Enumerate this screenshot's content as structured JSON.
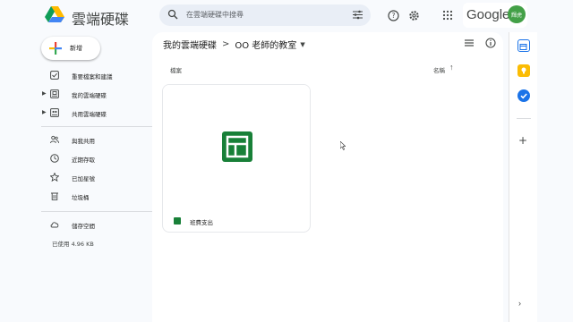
{
  "app": {
    "title": "雲端硬碟"
  },
  "search": {
    "placeholder": "在雲端硬碟中搜尋"
  },
  "account": {
    "brand": "Google",
    "avatar_text": "輝虎"
  },
  "new_button": {
    "label": "新增"
  },
  "sidebar": {
    "items": [
      {
        "label": "重要檔案和建議",
        "icon": "priority-icon",
        "caret": false
      },
      {
        "label": "我的雲端硬碟",
        "icon": "drive-icon",
        "caret": true
      },
      {
        "label": "共用雲端硬碟",
        "icon": "shared-drives-icon",
        "caret": true
      },
      {
        "label": "與我共用",
        "icon": "people-icon",
        "caret": false
      },
      {
        "label": "近期存取",
        "icon": "clock-icon",
        "caret": false
      },
      {
        "label": "已加星號",
        "icon": "star-icon",
        "caret": false
      },
      {
        "label": "垃圾桶",
        "icon": "trash-icon",
        "caret": false
      },
      {
        "label": "儲存空間",
        "icon": "cloud-icon",
        "caret": false
      }
    ],
    "storage_used": "已使用 4.96 KB"
  },
  "breadcrumb": {
    "root": "我的雲端硬碟",
    "separator": ">",
    "current": "OO 老師的教室"
  },
  "columns": {
    "name": "檔案",
    "owner": "名稱"
  },
  "files": [
    {
      "name": "班費支出",
      "type": "spreadsheet"
    }
  ],
  "colors": {
    "accent": "#1a73e8",
    "sheets_green": "#188038",
    "keep_yellow": "#fbbc04",
    "avatar_green": "#43a047"
  }
}
